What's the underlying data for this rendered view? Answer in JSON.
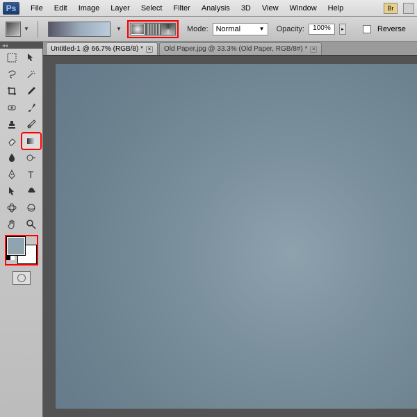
{
  "menu": {
    "items": [
      "File",
      "Edit",
      "Image",
      "Layer",
      "Select",
      "Filter",
      "Analysis",
      "3D",
      "View",
      "Window",
      "Help"
    ],
    "bridge": "Br"
  },
  "options": {
    "mode_label": "Mode:",
    "mode_value": "Normal",
    "opacity_label": "Opacity:",
    "opacity_value": "100%",
    "reverse_label": "Reverse"
  },
  "tabs": [
    {
      "label": "Untitled-1 @ 66.7% (RGB/8) *",
      "active": true
    },
    {
      "label": "Old Paper.jpg @ 33.3% (Old Paper, RGB/8#) *",
      "active": false
    }
  ],
  "colors": {
    "foreground": "#8fa4af",
    "background": "#ffffff"
  },
  "tools": [
    [
      "rect-marquee",
      "move"
    ],
    [
      "lasso",
      "magic-wand"
    ],
    [
      "crop",
      "eyedropper"
    ],
    [
      "heal",
      "brush"
    ],
    [
      "stamp",
      "history-brush"
    ],
    [
      "eraser",
      "gradient"
    ],
    [
      "blur",
      "dodge"
    ],
    [
      "pen",
      "type"
    ],
    [
      "path-select",
      "shape"
    ],
    [
      "3d-rotate",
      "3d-orbit"
    ],
    [
      "hand",
      "zoom"
    ]
  ],
  "highlighted_tools": [
    "gradient",
    "radial-gradient-type",
    "color-swatches"
  ]
}
